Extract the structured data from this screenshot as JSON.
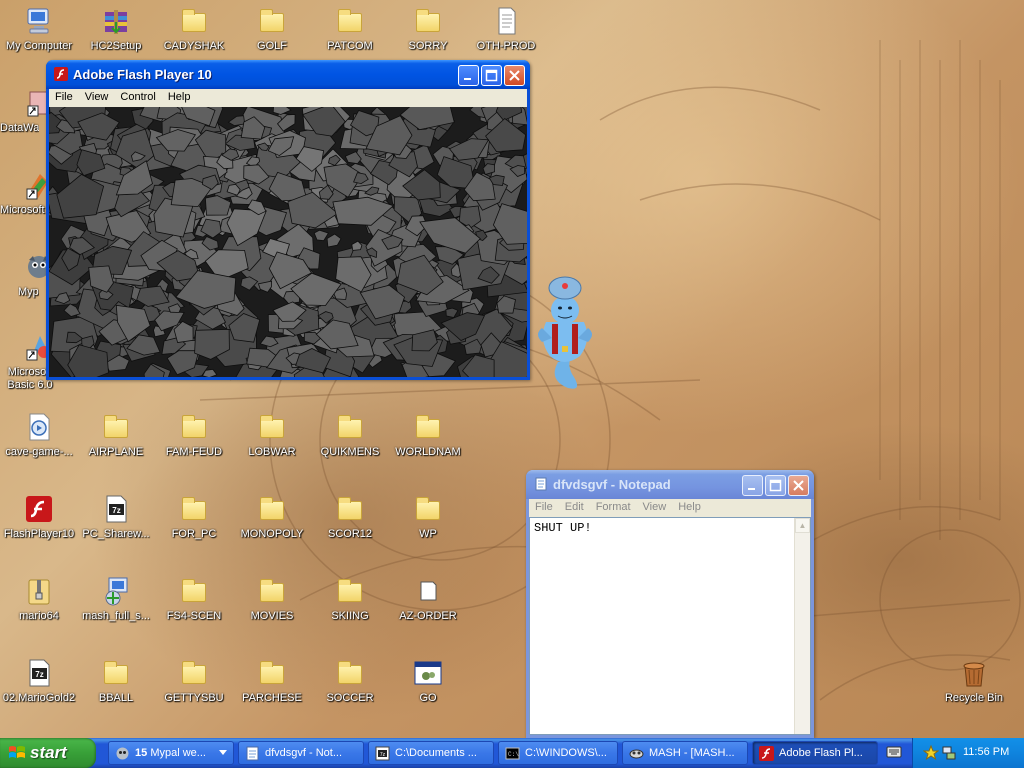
{
  "desktop": {
    "icons": [
      {
        "label": "My Computer",
        "icon": "my-computer-icon"
      },
      {
        "label": "HC2Setup",
        "icon": "winrar-archive-icon"
      },
      {
        "label": "CADYSHAK",
        "icon": "folder-icon"
      },
      {
        "label": "GOLF",
        "icon": "folder-icon"
      },
      {
        "label": "PATCOM",
        "icon": "folder-icon"
      },
      {
        "label": "SORRY",
        "icon": "folder-icon"
      },
      {
        "label": "OTH-PROD",
        "icon": "text-document-icon"
      },
      {
        "label": "DataWa",
        "icon": "shortcut-icon"
      },
      {
        "label": "Microsoft C++",
        "icon": "visual-cpp-icon"
      },
      {
        "label": "Myp",
        "icon": "mypal-icon"
      },
      {
        "label": "Microsoft Basic 6.0",
        "icon": "visual-basic-icon"
      },
      {
        "label": "cave-game-...",
        "icon": "media-file-icon"
      },
      {
        "label": "AIRPLANE",
        "icon": "folder-icon"
      },
      {
        "label": "FAM-FEUD",
        "icon": "folder-icon"
      },
      {
        "label": "LOBWAR",
        "icon": "folder-icon"
      },
      {
        "label": "QUIKMENS",
        "icon": "folder-icon"
      },
      {
        "label": "WORLDNAM",
        "icon": "folder-icon"
      },
      {
        "label": "FlashPlayer10",
        "icon": "flash-player-icon"
      },
      {
        "label": "PC_Sharew...",
        "icon": "7z-archive-icon"
      },
      {
        "label": "FOR_PC",
        "icon": "folder-icon"
      },
      {
        "label": "MONOPOLY",
        "icon": "folder-icon"
      },
      {
        "label": "SCOR12",
        "icon": "folder-icon"
      },
      {
        "label": "WP",
        "icon": "folder-icon"
      },
      {
        "label": "mario64",
        "icon": "zip-archive-icon"
      },
      {
        "label": "mash_full_s...",
        "icon": "installer-icon"
      },
      {
        "label": "FS4-SCEN",
        "icon": "folder-icon"
      },
      {
        "label": "MOVIES",
        "icon": "folder-icon"
      },
      {
        "label": "SKIING",
        "icon": "folder-icon"
      },
      {
        "label": "AZ-ORDER",
        "icon": "file-icon"
      },
      {
        "label": "02.MarioGold2",
        "icon": "7z-archive-icon"
      },
      {
        "label": "BBALL",
        "icon": "folder-icon"
      },
      {
        "label": "GETTYSBU",
        "icon": "folder-icon"
      },
      {
        "label": "PARCHESE",
        "icon": "folder-icon"
      },
      {
        "label": "SOCCER",
        "icon": "folder-icon"
      },
      {
        "label": "GO",
        "icon": "batch-file-icon"
      },
      {
        "label": "Recycle Bin",
        "icon": "recycle-bin-icon"
      }
    ]
  },
  "flash_window": {
    "title": "Adobe Flash Player 10",
    "menu": [
      "File",
      "View",
      "Control",
      "Help"
    ]
  },
  "notepad_window": {
    "title": "dfvdsgvf - Notepad",
    "menu": [
      "File",
      "Edit",
      "Format",
      "View",
      "Help"
    ],
    "content": "SHUT UP!"
  },
  "taskbar": {
    "start_label": "start",
    "buttons": [
      {
        "count": "15",
        "label": "Mypal we...",
        "icon": "mypal-icon"
      },
      {
        "label": "dfvdsgvf - Not...",
        "icon": "notepad-icon"
      },
      {
        "label": "C:\\Documents ...",
        "icon": "7z-archive-icon"
      },
      {
        "label": "C:\\WINDOWS\\...",
        "icon": "cmd-icon"
      },
      {
        "label": "MASH - [MASH...",
        "icon": "mash-icon"
      },
      {
        "label": "Adobe Flash Pl...",
        "icon": "flash-player-icon"
      }
    ],
    "clock": "11:56 PM"
  },
  "colors": {
    "xp_blue": "#0054e3",
    "start_green": "#38a038",
    "tray_blue": "#0f84de"
  }
}
